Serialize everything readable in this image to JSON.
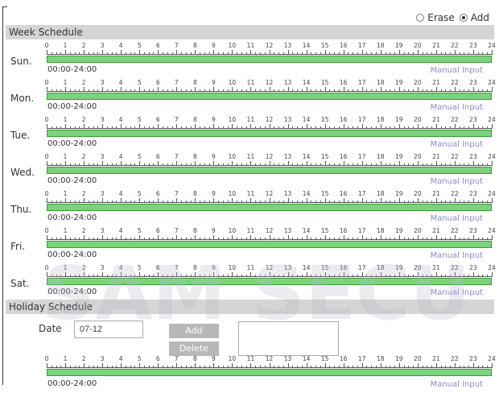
{
  "mode": {
    "erase_label": "Erase",
    "add_label": "Add",
    "selected": "add"
  },
  "week": {
    "title": "Week Schedule",
    "days": [
      {
        "label": "Sun.",
        "time": "00:00-24:00",
        "manual": "Manual Input"
      },
      {
        "label": "Mon.",
        "time": "00:00-24:00",
        "manual": "Manual Input"
      },
      {
        "label": "Tue.",
        "time": "00:00-24:00",
        "manual": "Manual Input"
      },
      {
        "label": "Wed.",
        "time": "00:00-24:00",
        "manual": "Manual Input"
      },
      {
        "label": "Thu.",
        "time": "00:00-24:00",
        "manual": "Manual Input"
      },
      {
        "label": "Fri.",
        "time": "00:00-24:00",
        "manual": "Manual Input"
      },
      {
        "label": "Sat.",
        "time": "00:00-24:00",
        "manual": "Manual Input"
      }
    ]
  },
  "hours": [
    "0",
    "1",
    "2",
    "3",
    "4",
    "5",
    "6",
    "7",
    "8",
    "9",
    "10",
    "11",
    "12",
    "13",
    "14",
    "15",
    "16",
    "17",
    "18",
    "19",
    "20",
    "21",
    "22",
    "23",
    "24"
  ],
  "holiday": {
    "title": "Holiday Schedule",
    "date_label": "Date",
    "date_value": "07-12",
    "add_label": "Add",
    "delete_label": "Delete",
    "time": "00:00-24:00",
    "manual": "Manual Input"
  },
  "colors": {
    "bar_fill": "#7dd37d",
    "bar_border": "#3a9a3a",
    "header_bg": "#d5d5d5",
    "manual_link": "#8a8ac8"
  },
  "watermark": "SAM SECU"
}
